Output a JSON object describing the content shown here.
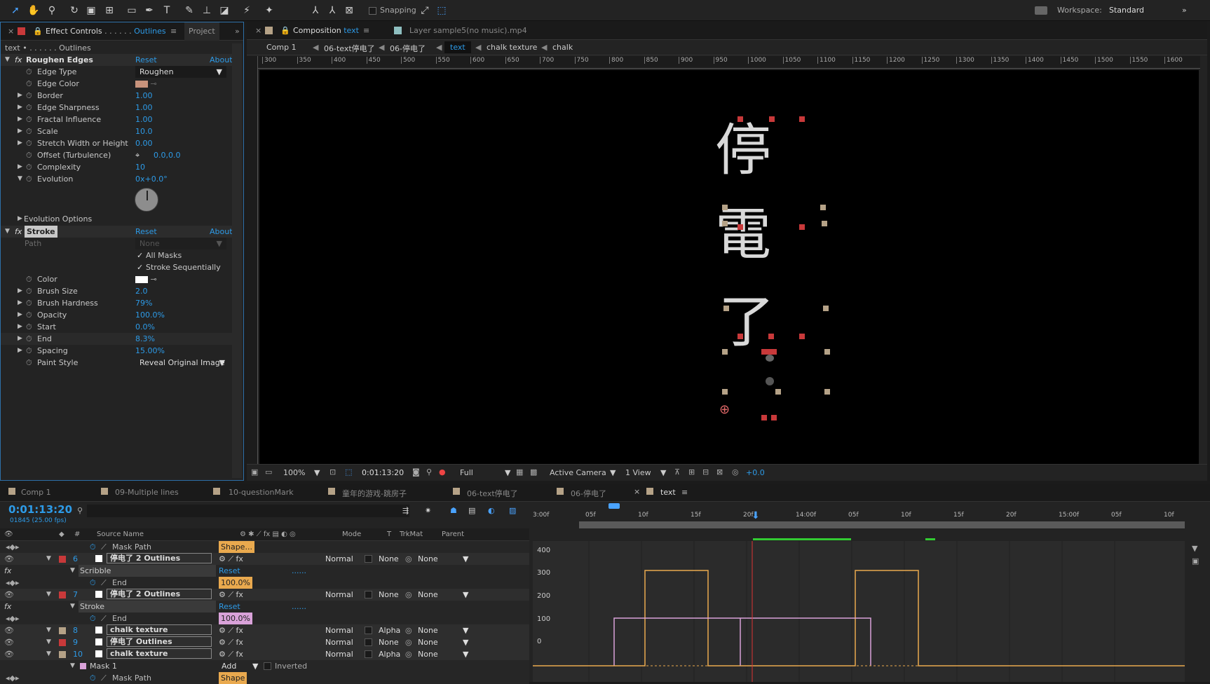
{
  "toolbar": {
    "snapping": "Snapping",
    "workspace_label": "Workspace:",
    "workspace_value": "Standard"
  },
  "left_tabs": {
    "effect_controls": "Effect Controls",
    "effect_layer": "Outlines",
    "project": "Project"
  },
  "breadcrumb": "text • . . . . . . Outlines",
  "roughen": {
    "title": "Roughen Edges",
    "reset": "Reset",
    "about": "About.",
    "props": [
      {
        "name": "Edge Type",
        "value": "Roughen"
      },
      {
        "name": "Edge Color",
        "value": ""
      },
      {
        "name": "Border",
        "value": "1.00"
      },
      {
        "name": "Edge Sharpness",
        "value": "1.00"
      },
      {
        "name": "Fractal Influence",
        "value": "1.00"
      },
      {
        "name": "Scale",
        "value": "10.0"
      },
      {
        "name": "Stretch Width or Height",
        "value": "0.00"
      },
      {
        "name": "Offset (Turbulence)",
        "value": "0.0,0.0"
      },
      {
        "name": "Complexity",
        "value": "10"
      },
      {
        "name": "Evolution",
        "value": "0x+0.0°"
      }
    ],
    "evolution_options": "Evolution Options"
  },
  "stroke": {
    "title": "Stroke",
    "reset": "Reset",
    "about": "About.",
    "path_label": "Path",
    "path_value": "None",
    "all_masks": "All Masks",
    "stroke_seq": "Stroke Sequentially",
    "props": [
      {
        "name": "Color",
        "value": ""
      },
      {
        "name": "Brush Size",
        "value": "2.0"
      },
      {
        "name": "Brush Hardness",
        "value": "79%"
      },
      {
        "name": "Opacity",
        "value": "100.0%"
      },
      {
        "name": "Start",
        "value": "0.0%"
      },
      {
        "name": "End",
        "value": "8.3%"
      },
      {
        "name": "Spacing",
        "value": "15.00%"
      },
      {
        "name": "Paint Style",
        "value": "Reveal Original Image"
      }
    ]
  },
  "comp_tabs": {
    "composition": "Composition",
    "comp_name": "text",
    "layer_tab": "Layer sample5(no music).mp4"
  },
  "comp_breadcrumbs": [
    "Comp 1",
    "06-text停电了",
    "06-停电了",
    "text",
    "chalk texture",
    "chalk"
  ],
  "ruler_ticks": [
    "300",
    "350",
    "400",
    "450",
    "500",
    "550",
    "600",
    "650",
    "700",
    "750",
    "800",
    "850",
    "900",
    "950",
    "1000",
    "1050",
    "1100",
    "1150",
    "1200",
    "1250",
    "1300",
    "1350",
    "1400",
    "1450",
    "1500",
    "1550",
    "1600"
  ],
  "viewer_text": [
    "停",
    "電",
    "了"
  ],
  "viewer_footer": {
    "zoom": "100%",
    "timecode": "0:01:13:20",
    "resolution": "Full",
    "camera": "Active Camera",
    "views": "1 View",
    "exposure": "+0.0"
  },
  "timeline_tabs": [
    "Comp 1",
    "09-Multiple lines",
    "10-questionMark",
    "童年的游戏-跳房子",
    "06-text停电了",
    "06-停电了",
    "text"
  ],
  "timeline": {
    "timecode": "0:01:13:20",
    "fps": "01845 (25.00 fps)",
    "headers": {
      "source": "Source Name",
      "mode": "Mode",
      "t": "T",
      "trkmat": "TrkMat",
      "parent": "Parent"
    },
    "time_ticks": [
      "3:00f",
      "05f",
      "10f",
      "15f",
      "20f",
      "14:00f",
      "05f",
      "10f",
      "15f",
      "20f",
      "15:00f",
      "05f",
      "10f"
    ],
    "graph_values": [
      "400",
      "300",
      "200",
      "100",
      "0"
    ],
    "rows": [
      {
        "kind": "prop",
        "name": "Mask Path",
        "val": "Shape..."
      },
      {
        "kind": "layer",
        "num": "6",
        "name": "停电了 2 Outlines",
        "mode": "Normal",
        "trk": "None",
        "parent": "None",
        "color": "#c8393a"
      },
      {
        "kind": "fx",
        "name": "Scribble",
        "val": "Reset",
        "extra": "......"
      },
      {
        "kind": "prop",
        "name": "End",
        "val": "100.0%"
      },
      {
        "kind": "layer",
        "num": "7",
        "name": "停电了 2 Outlines",
        "mode": "Normal",
        "trk": "None",
        "parent": "None",
        "color": "#c8393a"
      },
      {
        "kind": "fx",
        "name": "Stroke",
        "val": "Reset",
        "extra": "......"
      },
      {
        "kind": "prop",
        "name": "End",
        "val": "100.0%"
      },
      {
        "kind": "layer",
        "num": "8",
        "name": "chalk texture",
        "mode": "Normal",
        "trk": "Alpha",
        "parent": "None",
        "color": "#b5a287"
      },
      {
        "kind": "layer",
        "num": "9",
        "name": "停电了 Outlines",
        "mode": "Normal",
        "trk": "None",
        "parent": "None",
        "color": "#c8393a"
      },
      {
        "kind": "layer",
        "num": "10",
        "name": "chalk texture",
        "mode": "Normal",
        "trk": "Alpha",
        "parent": "None",
        "color": "#b5a287"
      },
      {
        "kind": "mask",
        "name": "Mask 1",
        "val": "Add",
        "extra": "Inverted"
      },
      {
        "kind": "prop",
        "name": "Mask Path",
        "val": "Shape"
      }
    ]
  }
}
